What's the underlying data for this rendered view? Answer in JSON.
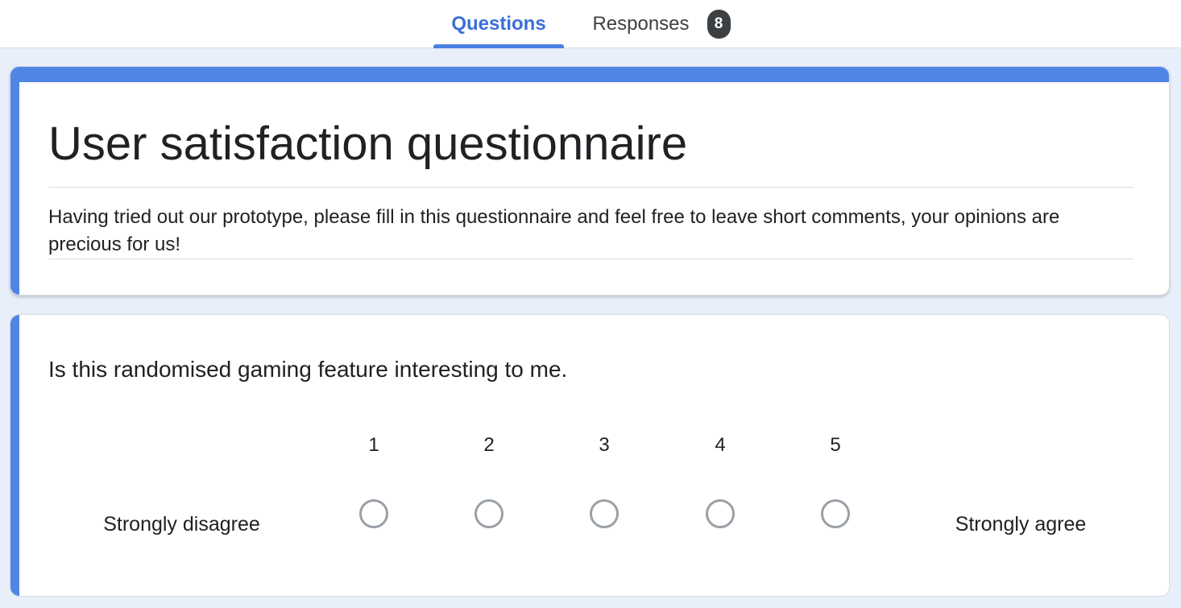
{
  "tabs": {
    "questions_label": "Questions",
    "responses_label": "Responses",
    "responses_count": "8"
  },
  "form": {
    "title": "User satisfaction questionnaire",
    "description": "Having tried out our prototype, please fill in this questionnaire and feel free to leave short comments, your opinions are precious for us!"
  },
  "question": {
    "text": "Is this randomised gaming feature interesting to me.",
    "low_label": "Strongly disagree",
    "high_label": "Strongly agree",
    "options": [
      "1",
      "2",
      "3",
      "4",
      "5"
    ]
  },
  "colors": {
    "accent": "#4f86e6",
    "tab_active_text": "#3b6fd9",
    "background": "#e8eefa",
    "badge": "#3c4043"
  }
}
